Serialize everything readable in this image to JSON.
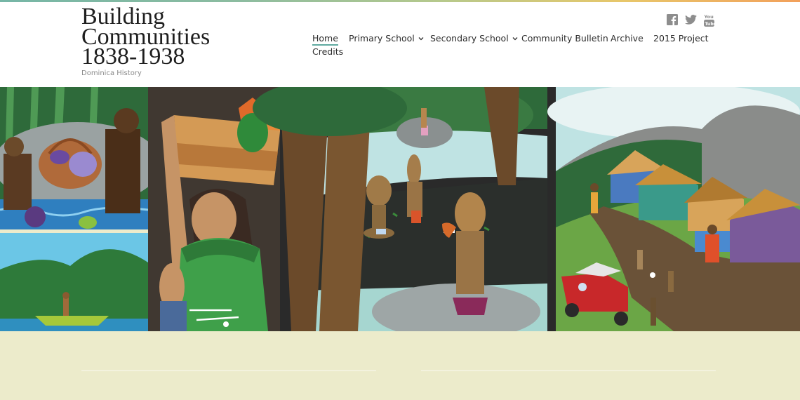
{
  "site": {
    "title_line1": "Building",
    "title_line2": "Communities",
    "title_line3": "1838-1938",
    "tagline": "Dominica History"
  },
  "social": [
    {
      "name": "facebook",
      "icon": "facebook-icon"
    },
    {
      "name": "twitter",
      "icon": "twitter-icon"
    },
    {
      "name": "youtube",
      "icon": "youtube-icon"
    }
  ],
  "nav": {
    "home": "Home",
    "primary": "Primary School",
    "secondary": "Secondary School",
    "bulletin": "Community Bulletin",
    "archive": "Archive",
    "project": "2015 Project",
    "credits": "Credits"
  },
  "colors": {
    "accent": "#5fa9a0",
    "page_background": "#ecebcb",
    "header_background": "#ffffff",
    "text": "#2d2d2d"
  }
}
